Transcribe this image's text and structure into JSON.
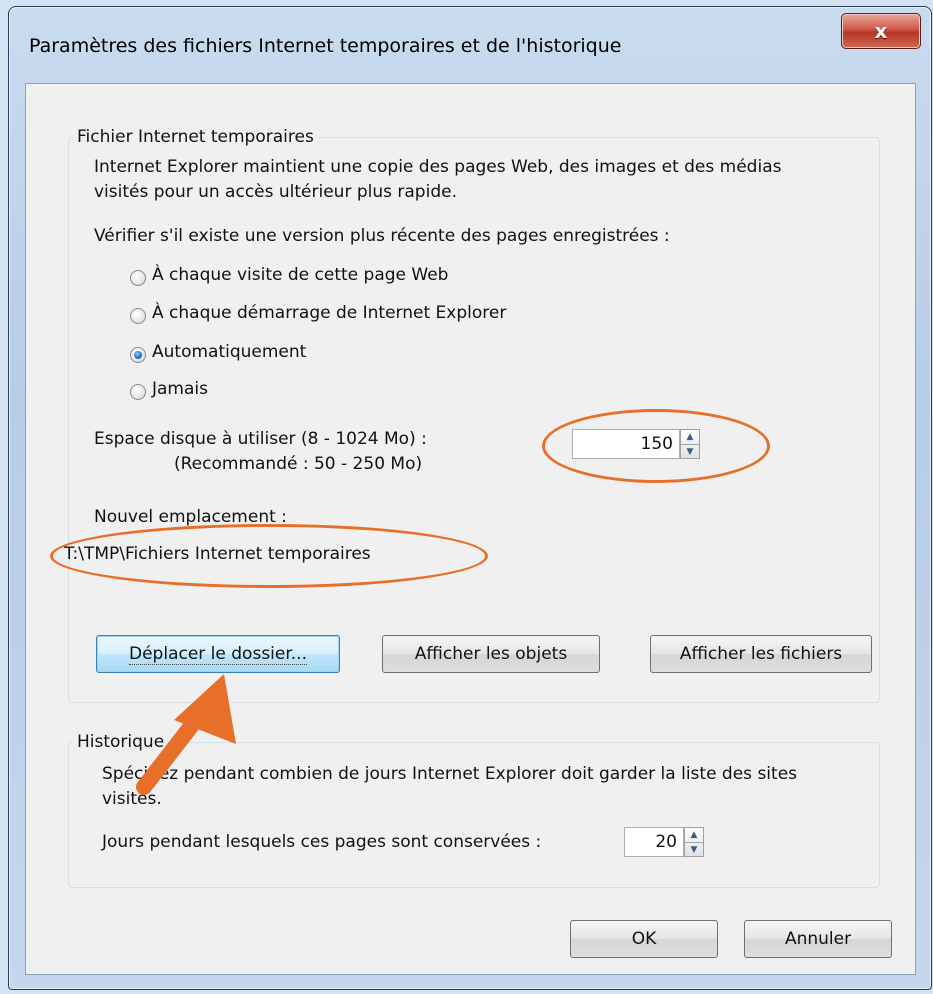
{
  "window": {
    "title": "Paramètres des fichiers Internet temporaires et de l'historique",
    "close_label": "x"
  },
  "temp_files": {
    "legend": "Fichier Internet temporaires",
    "description_line1": "Internet Explorer maintient une copie des pages Web, des images et des médias",
    "description_line2": "visités pour un accès ultérieur plus rapide.",
    "check_label": "Vérifier s'il existe une version plus récente des pages enregistrées :",
    "radio_options": [
      {
        "label": "À chaque visite de cette page Web",
        "checked": false
      },
      {
        "label": "À chaque démarrage de Internet Explorer",
        "checked": false
      },
      {
        "label": "Automatiquement",
        "checked": true
      },
      {
        "label": "Jamais",
        "checked": false
      }
    ],
    "disk_space_label": "Espace disque à utiliser (8 - 1024 Mo) :",
    "disk_space_recommended": "(Recommandé : 50 - 250 Mo)",
    "disk_space_value": "150",
    "new_location_label": "Nouvel emplacement :",
    "new_location_path": "T:\\TMP\\Fichiers Internet temporaires",
    "buttons": {
      "move_folder": "Déplacer le dossier...",
      "view_objects": "Afficher les objets",
      "view_files": "Afficher les fichiers"
    }
  },
  "history": {
    "legend": "Historique",
    "description_line1": "Spécifiez pendant combien de jours Internet Explorer doit garder la liste des sites",
    "description_line2": "visités.",
    "days_label": "Jours pendant lesquels ces pages sont conservées :",
    "days_value": "20"
  },
  "footer": {
    "ok": "OK",
    "cancel": "Annuler"
  },
  "colors": {
    "annotation": "#e86f2a",
    "title_gradient_top": "#c9dbef",
    "close_red": "#c0392b"
  }
}
